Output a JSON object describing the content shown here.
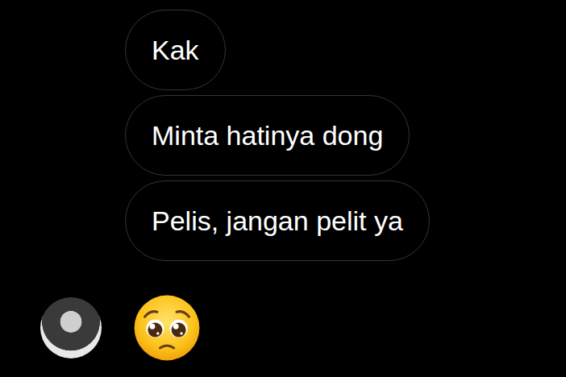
{
  "messages": [
    {
      "kind": "text",
      "text": "Kak"
    },
    {
      "kind": "text",
      "text": "Minta hatinya dong"
    },
    {
      "kind": "text",
      "text": "Pelis, jangan pelit ya"
    },
    {
      "kind": "emoji"
    }
  ]
}
